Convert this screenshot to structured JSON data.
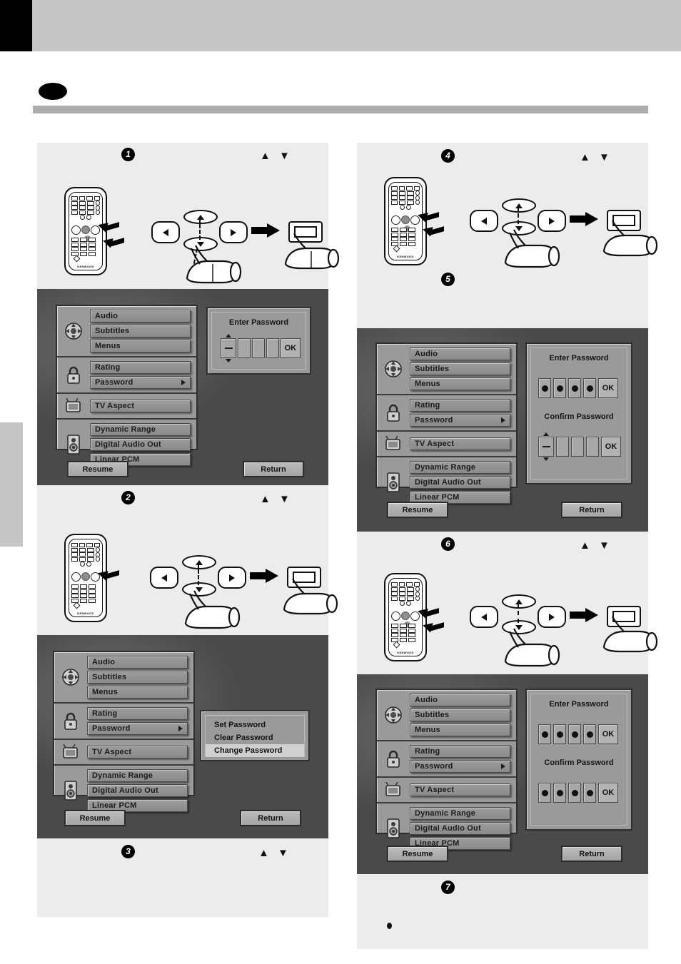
{
  "page": {
    "brand": "KENWOOD",
    "side_tab": "",
    "nav_updown_glyphs": "▲ ▼"
  },
  "steps": {
    "one": "1",
    "two": "2",
    "three": "3",
    "four": "4",
    "five": "5",
    "six": "6",
    "seven": "7"
  },
  "osd": {
    "groups": [
      {
        "icon": "disc-icon",
        "items": [
          {
            "label": "Audio",
            "arrow": false
          },
          {
            "label": "Subtitles",
            "arrow": false
          },
          {
            "label": "Menus",
            "arrow": false
          }
        ]
      },
      {
        "icon": "lock-icon",
        "items": [
          {
            "label": "Rating",
            "arrow": false
          },
          {
            "label": "Password",
            "arrow": true
          }
        ]
      },
      {
        "icon": "tv-icon",
        "items": [
          {
            "label": "TV Aspect",
            "arrow": false
          }
        ]
      },
      {
        "icon": "speaker-icon",
        "items": [
          {
            "label": "Dynamic Range",
            "arrow": false
          },
          {
            "label": "Digital Audio Out",
            "arrow": false
          },
          {
            "label": "Linear PCM",
            "arrow": false
          }
        ]
      }
    ],
    "resume_label": "Resume",
    "return_label": "Return",
    "enter_password_title": "Enter Password",
    "confirm_password_title": "Confirm Password",
    "ok_label": "OK",
    "submenu_items": [
      {
        "label": "Set Password",
        "selected": false
      },
      {
        "label": "Clear Password",
        "selected": false
      },
      {
        "label": "Change Password",
        "selected": true
      }
    ]
  },
  "screens": {
    "s1": {
      "password_filled": 0,
      "password_cells": 4,
      "has_confirm": false,
      "confirm_filled": 0
    },
    "s2": {
      "has_submenu": true
    },
    "s3": {
      "password_filled": 4,
      "password_cells": 4,
      "has_confirm": true,
      "confirm_filled": 0
    },
    "s4": {
      "password_filled": 4,
      "password_cells": 4,
      "has_confirm": true,
      "confirm_filled": 4
    }
  }
}
